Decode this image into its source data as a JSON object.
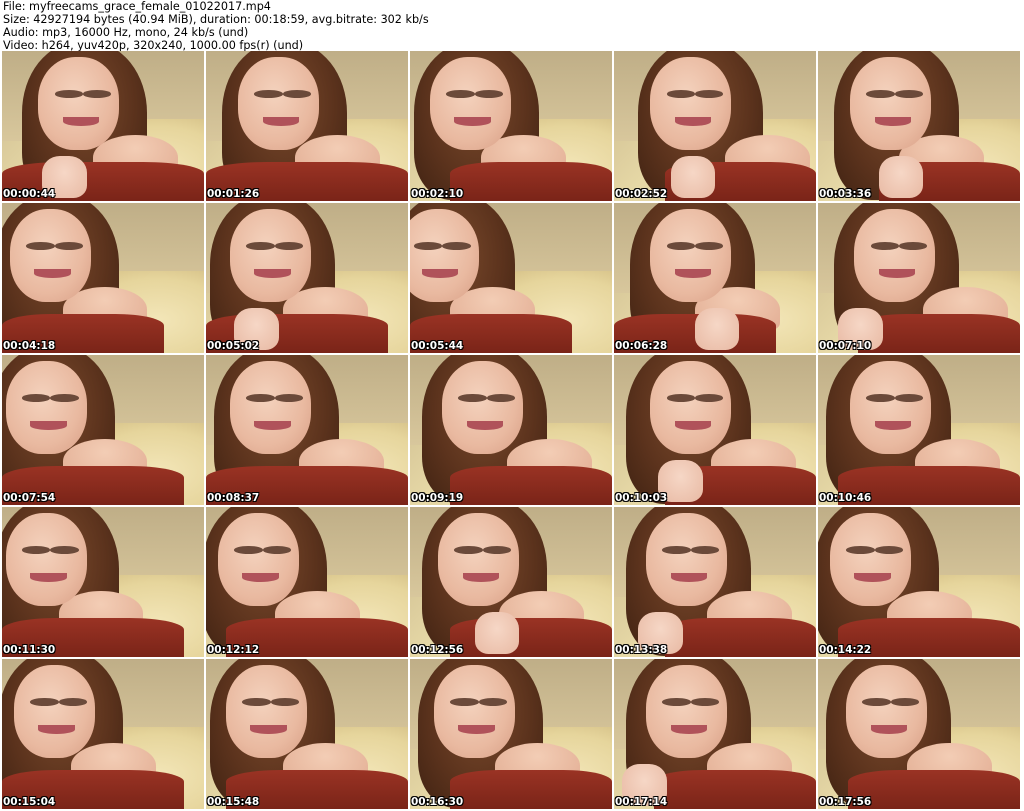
{
  "header": {
    "file_line": "File: myfreecams_grace_female_01022017.mp4",
    "size_line": "Size: 42927194 bytes (40.94 MiB), duration: 00:18:59, avg.bitrate: 302 kb/s",
    "audio_line": "Audio: mp3, 16000 Hz, mono, 24 kb/s (und)",
    "video_line": "Video: h264, yuv420p, 320x240, 1000.00 fps(r) (und)"
  },
  "thumbnails": [
    {
      "timestamp": "00:00:44"
    },
    {
      "timestamp": "00:01:26"
    },
    {
      "timestamp": "00:02:10"
    },
    {
      "timestamp": "00:02:52"
    },
    {
      "timestamp": "00:03:36"
    },
    {
      "timestamp": "00:04:18"
    },
    {
      "timestamp": "00:05:02"
    },
    {
      "timestamp": "00:05:44"
    },
    {
      "timestamp": "00:06:28"
    },
    {
      "timestamp": "00:07:10"
    },
    {
      "timestamp": "00:07:54"
    },
    {
      "timestamp": "00:08:37"
    },
    {
      "timestamp": "00:09:19"
    },
    {
      "timestamp": "00:10:03"
    },
    {
      "timestamp": "00:10:46"
    },
    {
      "timestamp": "00:11:30"
    },
    {
      "timestamp": "00:12:12"
    },
    {
      "timestamp": "00:12:56"
    },
    {
      "timestamp": "00:13:38"
    },
    {
      "timestamp": "00:14:22"
    },
    {
      "timestamp": "00:15:04"
    },
    {
      "timestamp": "00:15:48"
    },
    {
      "timestamp": "00:16:30"
    },
    {
      "timestamp": "00:17:14"
    },
    {
      "timestamp": "00:17:56"
    }
  ]
}
